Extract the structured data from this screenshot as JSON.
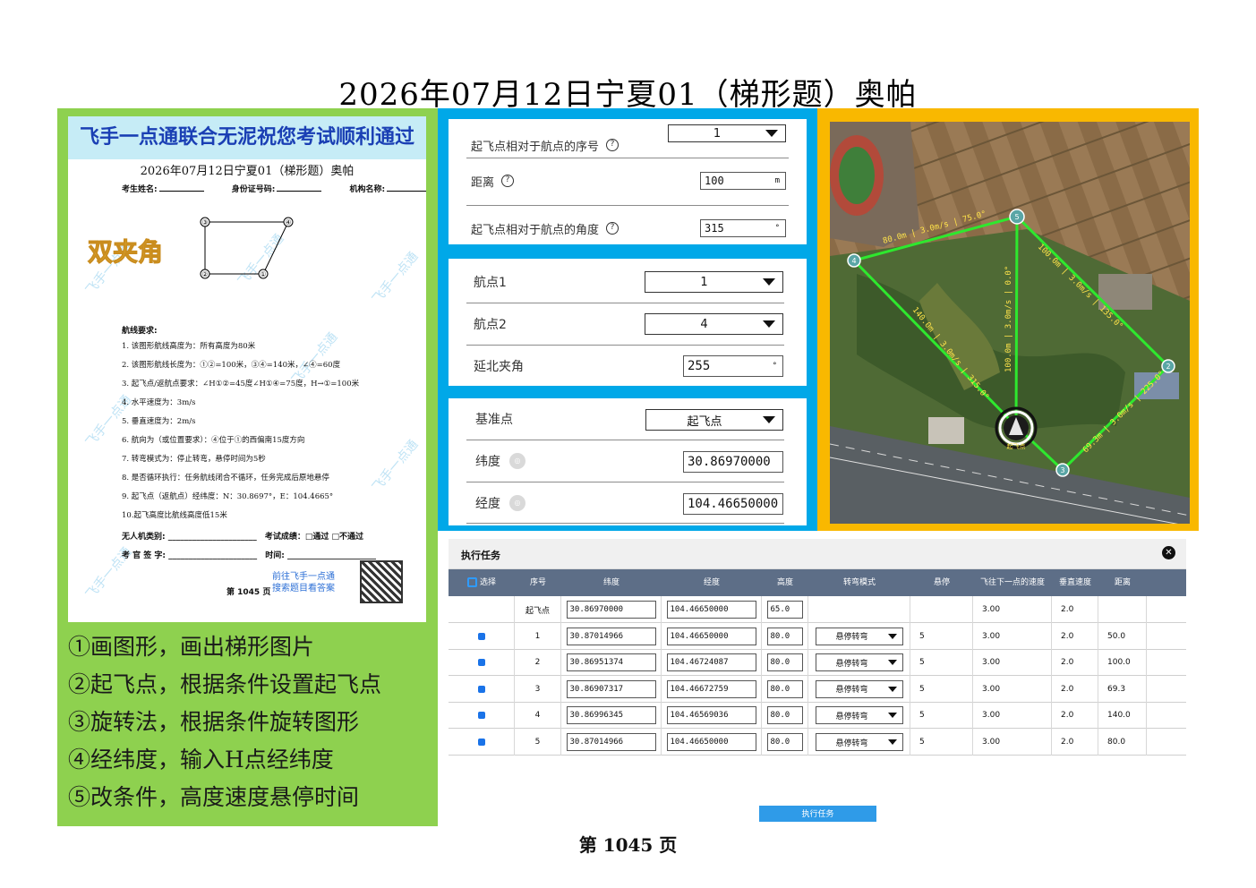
{
  "title": "2026年07月12日宁夏01（梯形题）奥帕",
  "footer": "第 1045 页",
  "paper": {
    "banner": "飞手一点通联合无泥祝您考试顺利通过",
    "title": "2026年07月12日宁夏01（梯形题）奥帕",
    "fields": [
      "考生姓名:",
      "身份证号码:",
      "机构名称:"
    ],
    "stamp": "双夹角",
    "watermark": "飞手一点通",
    "diagram_points": [
      "③",
      "④",
      "②",
      "①"
    ],
    "req_heading": "航线要求:",
    "requirements": [
      "1. 该图形航线高度为：所有高度为80米",
      "2. 该图形航线长度为：①②=100米，③④=140米，∠④=60度",
      "3. 起飞点/返航点要求：∠H①②=45度∠H①④=75度，H→①=100米",
      "4. 水平速度为：3m/s",
      "5. 垂直速度为：2m/s",
      "6. 航向为（或位置要求）：④位于①的西偏南15度方向",
      "7. 转弯模式为：停止转弯，悬停时间为5秒",
      "8. 是否循环执行：任务航线闭合不循环，任务完成后原地悬停",
      "9. 起飞点（返航点）经纬度：N：30.8697°，E：104.4665°",
      "10.起飞高度比航线高度低15米"
    ],
    "line1_label": "无人机类别:",
    "line1_result": "考试成绩：□通过  □不通过",
    "line2_label": "考 官 签 字:",
    "line2_time": "时间:",
    "page": "第 1045 页",
    "link1": "前往飞手一点通",
    "link2": "搜索题目看答案"
  },
  "steps": [
    "①画图形，画出梯形图片",
    "②起飞点，根据条件设置起飞点",
    "③旋转法，根据条件旋转图形",
    "④经纬度，输入H点经纬度",
    "⑤改条件，高度速度悬停时间"
  ],
  "takeoff": {
    "seq_label": "起飞点相对于航点的序号",
    "seq_value": "1",
    "dist_label": "距离",
    "dist_value": "100",
    "dist_unit": "m",
    "angle_label": "起飞点相对于航点的角度",
    "angle_value": "315",
    "angle_unit": "°"
  },
  "waypoints": {
    "wp1_label": "航点1",
    "wp1_value": "1",
    "wp2_label": "航点2",
    "wp2_value": "4",
    "north_label": "延北夹角",
    "north_value": "255",
    "north_unit": "°"
  },
  "reference": {
    "base_label": "基准点",
    "base_value": "起飞点",
    "lat_label": "纬度",
    "lat_value": "30.86970000",
    "lon_label": "经度",
    "lon_value": "104.46650000"
  },
  "map": {
    "labels": [
      "80.0m | 3.0m/s | 75.0°",
      "100.0m | 3.0m/s | 135.0°",
      "140.0m | 3.0m/s | 315.0°",
      "100.0m | 3.0m/s | 0.0°",
      "69.3m | 3.0m/s | 225.0°"
    ],
    "points": [
      "1",
      "2",
      "3",
      "4",
      "5"
    ],
    "home_label": "起飞点"
  },
  "task": {
    "title": "执行任务",
    "headers": [
      "选择",
      "序号",
      "纬度",
      "经度",
      "高度",
      "转弯模式",
      "悬停",
      "飞往下一点的速度",
      "垂直速度",
      "距离"
    ],
    "rows": [
      {
        "seq": "起飞点",
        "lat": "30.86970000",
        "lon": "104.46650000",
        "alt": "65.0",
        "turn": "",
        "hover": "",
        "speed": "3.00",
        "vspeed": "2.0",
        "dist": ""
      },
      {
        "seq": "1",
        "lat": "30.87014966",
        "lon": "104.46650000",
        "alt": "80.0",
        "turn": "悬停转弯",
        "hover": "5",
        "speed": "3.00",
        "vspeed": "2.0",
        "dist": "50.0"
      },
      {
        "seq": "2",
        "lat": "30.86951374",
        "lon": "104.46724087",
        "alt": "80.0",
        "turn": "悬停转弯",
        "hover": "5",
        "speed": "3.00",
        "vspeed": "2.0",
        "dist": "100.0"
      },
      {
        "seq": "3",
        "lat": "30.86907317",
        "lon": "104.46672759",
        "alt": "80.0",
        "turn": "悬停转弯",
        "hover": "5",
        "speed": "3.00",
        "vspeed": "2.0",
        "dist": "69.3"
      },
      {
        "seq": "4",
        "lat": "30.86996345",
        "lon": "104.46569036",
        "alt": "80.0",
        "turn": "悬停转弯",
        "hover": "5",
        "speed": "3.00",
        "vspeed": "2.0",
        "dist": "140.0"
      },
      {
        "seq": "5",
        "lat": "30.87014966",
        "lon": "104.46650000",
        "alt": "80.0",
        "turn": "悬停转弯",
        "hover": "5",
        "speed": "3.00",
        "vspeed": "2.0",
        "dist": "80.0"
      }
    ],
    "button": "执行任务"
  },
  "colors": {
    "green_panel": "#8ed14f",
    "blue_panel": "#00a8e8",
    "gold_panel": "#f9b800",
    "table_header": "#5d6e87",
    "route": "#2ee82e"
  }
}
